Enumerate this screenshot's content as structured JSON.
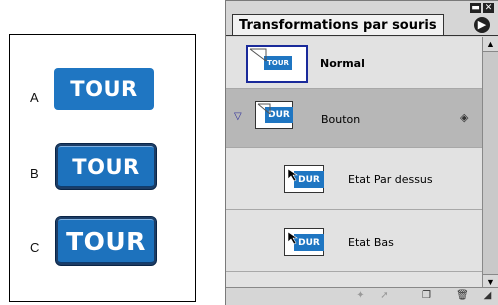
{
  "figure": {
    "rows": [
      {
        "label": "A",
        "button_text": "TOUR"
      },
      {
        "label": "B",
        "button_text": "TOUR"
      },
      {
        "label": "C",
        "button_text": "TOUR"
      }
    ],
    "button_color": "#1f76c2"
  },
  "panel": {
    "tab_title": "Transformations par souris",
    "window_controls": [
      "minimize-icon",
      "close-icon"
    ],
    "items": [
      {
        "label": "Normal",
        "thumb_text": "TOUR",
        "selected": false
      },
      {
        "label": "Bouton",
        "thumb_text": "DUR",
        "selected": true
      },
      {
        "label": "Etat Par dessus",
        "thumb_text": "DUR",
        "selected": false
      },
      {
        "label": "Etat Bas",
        "thumb_text": "DUR",
        "selected": false
      }
    ],
    "bottom_icons": [
      "new-state-icon",
      "new-layer-icon",
      "trash-icon",
      "resize-grip-icon"
    ]
  }
}
